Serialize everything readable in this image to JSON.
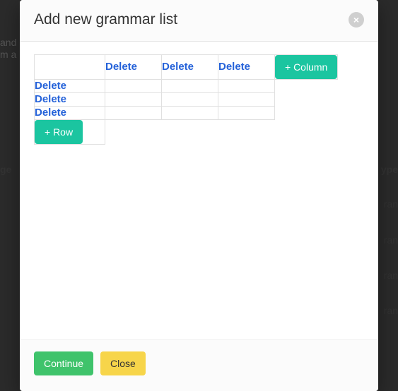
{
  "background": {
    "left_line1": "and",
    "left_line2": "m a",
    "col_left": "ge",
    "col_right": "ype",
    "cell_right": "ran"
  },
  "modal": {
    "title": "Add new grammar list",
    "close_glyph": "×",
    "delete_label": "Delete",
    "add_column_label": "+ Column",
    "add_row_label": "+ Row",
    "continue_label": "Continue",
    "close_label": "Close"
  }
}
